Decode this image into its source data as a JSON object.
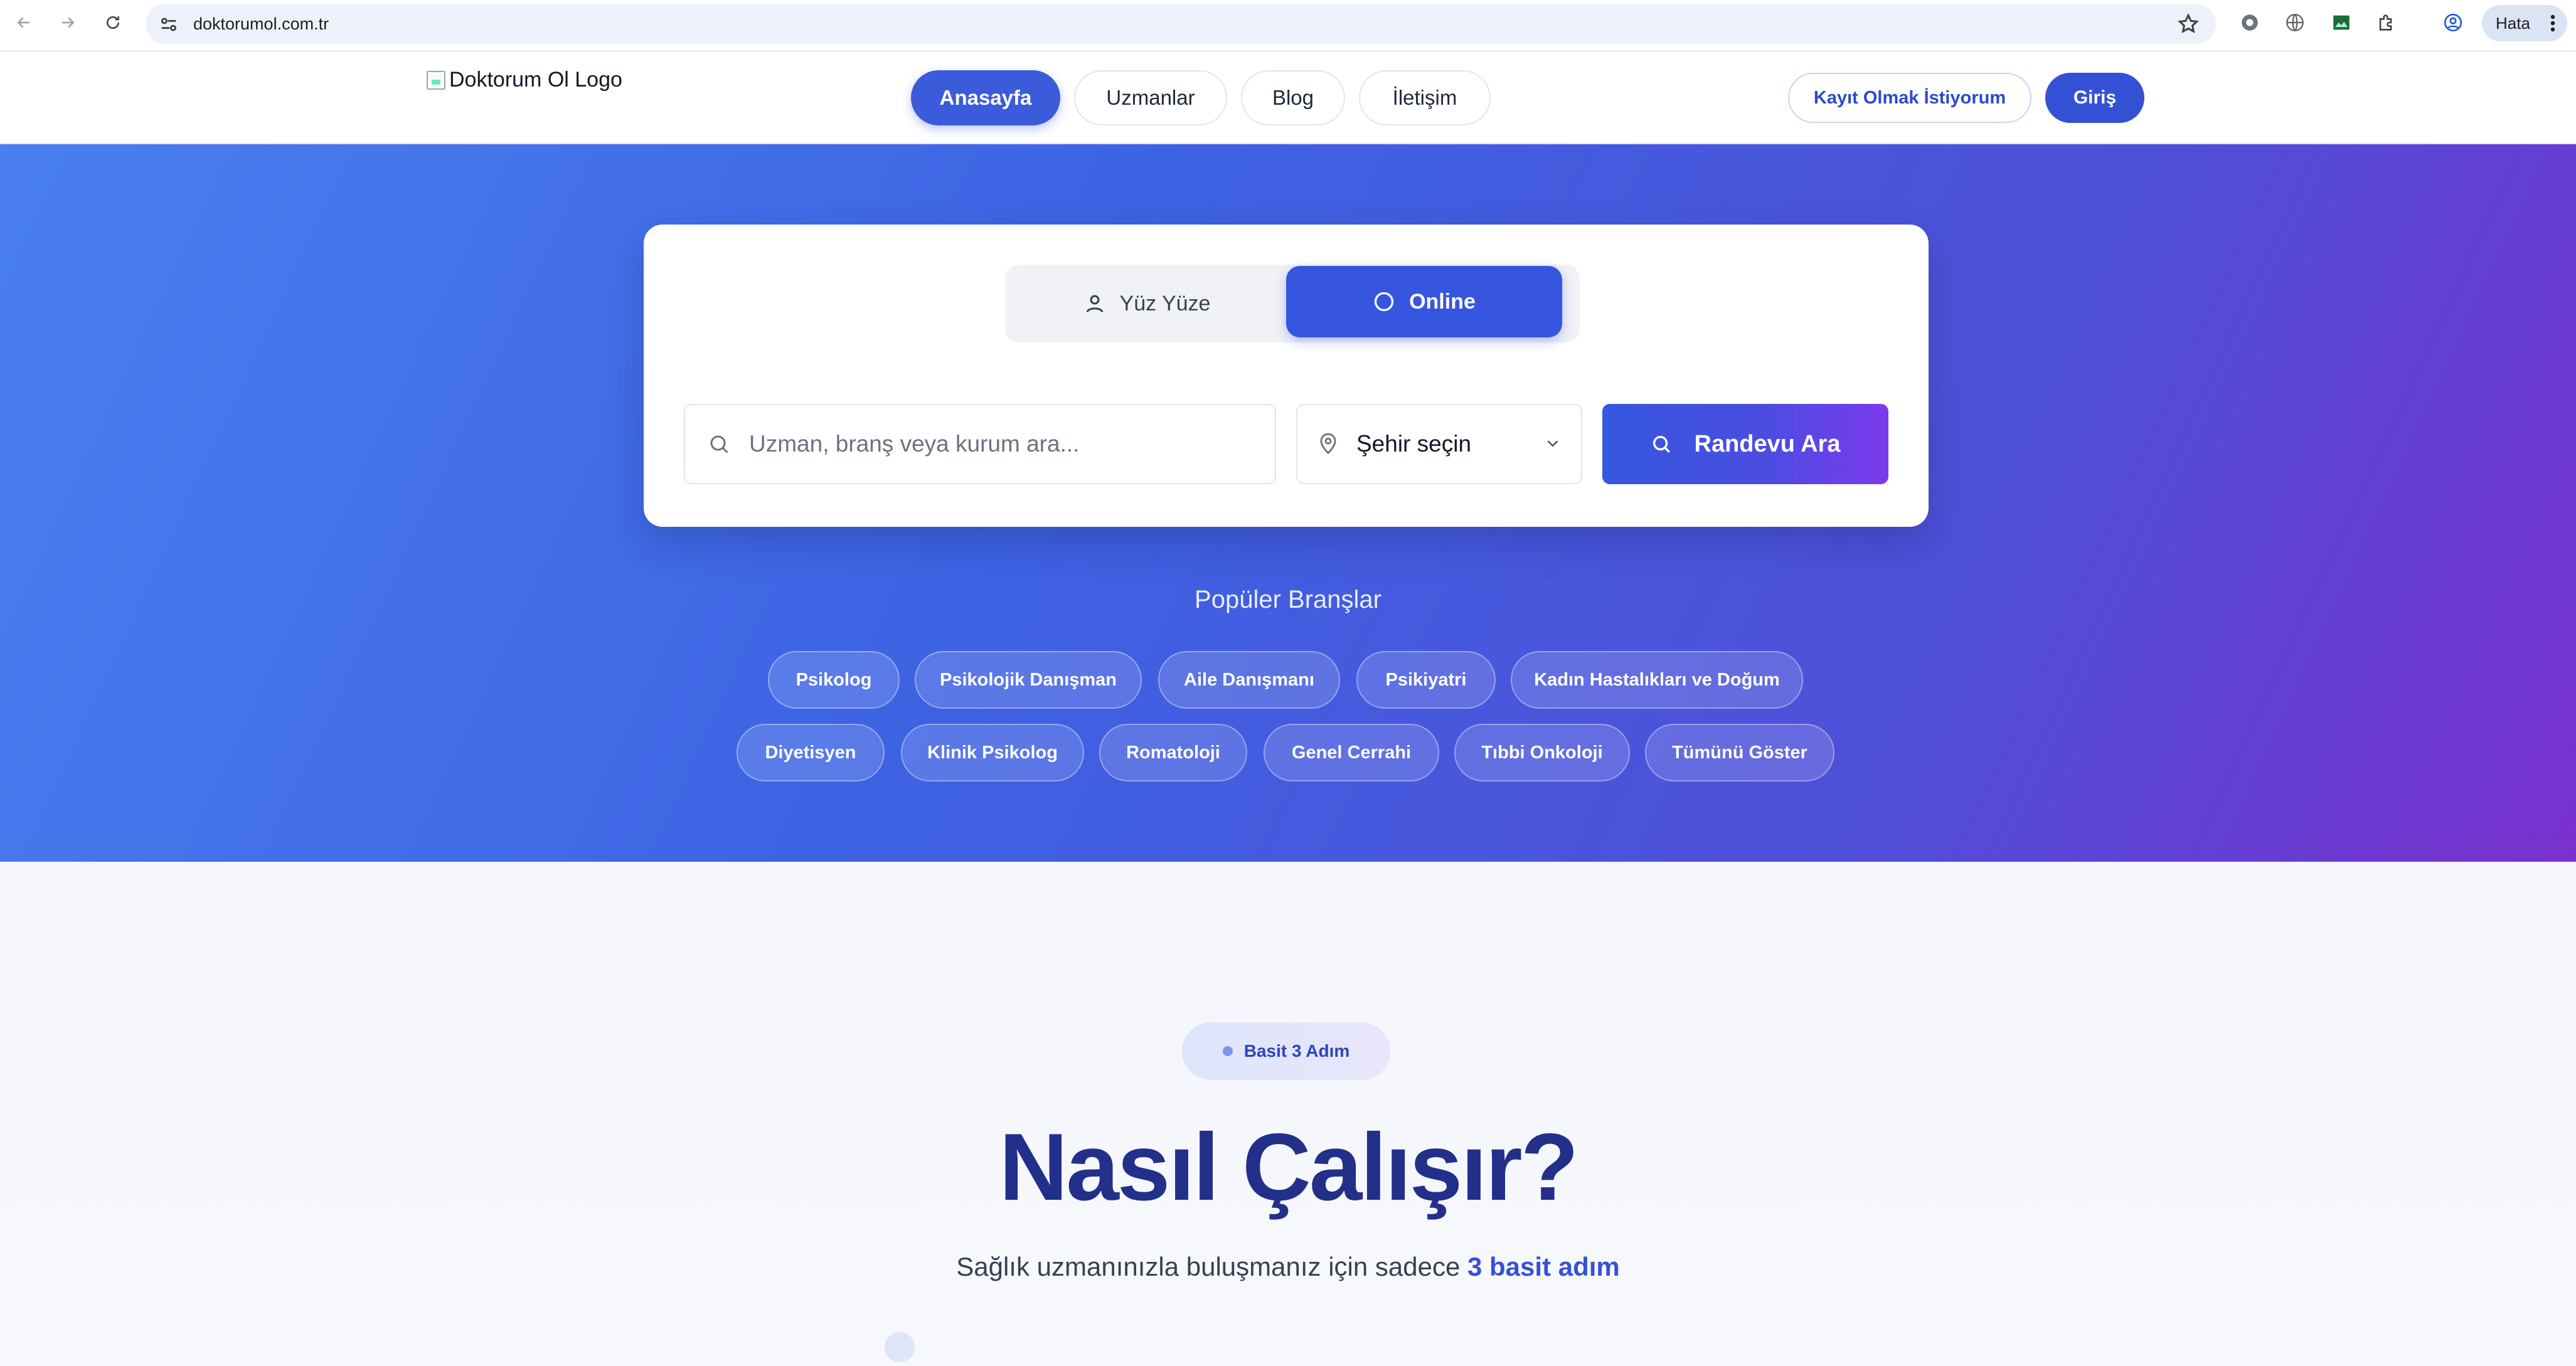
{
  "browser": {
    "url": "doktorumol.com.tr",
    "profile_label": "Hata"
  },
  "header": {
    "logo_alt": "Doktorum Ol Logo",
    "nav": [
      {
        "label": "Anasayfa",
        "active": true
      },
      {
        "label": "Uzmanlar",
        "active": false
      },
      {
        "label": "Blog",
        "active": false
      },
      {
        "label": "İletişim",
        "active": false
      }
    ],
    "register_label": "Kayıt Olmak İstiyorum",
    "login_label": "Giriş"
  },
  "search": {
    "mode_options": [
      {
        "label": "Yüz Yüze",
        "icon": "user-icon",
        "selected": false
      },
      {
        "label": "Online",
        "icon": "circle-icon",
        "selected": true
      }
    ],
    "query_placeholder": "Uzman, branş veya kurum ara...",
    "city_value": "Şehir seçin",
    "submit_label": "Randevu Ara"
  },
  "popular": {
    "title": "Popüler Branşlar",
    "row1": [
      "Psikolog",
      "Psikolojik Danışman",
      "Aile Danışmanı",
      "Psikiyatri",
      "Kadın Hastalıkları ve Doğum"
    ],
    "row2": [
      "Diyetisyen",
      "Klinik Psikolog",
      "Romatoloji",
      "Genel Cerrahi",
      "Tıbbi Onkoloji",
      "Tümünü Göster"
    ]
  },
  "how": {
    "badge": "Basit 3 Adım",
    "title": "Nasıl Çalışır?",
    "subtitle_prefix": "Sağlık uzmanınızla buluşmanız için sadece",
    "subtitle_highlight": "3 basit adım"
  },
  "colors": {
    "primary": "#3b5bdb",
    "hero_start": "#4a7ff0",
    "hero_end": "#7a30cf",
    "title_navy": "#22308a"
  }
}
